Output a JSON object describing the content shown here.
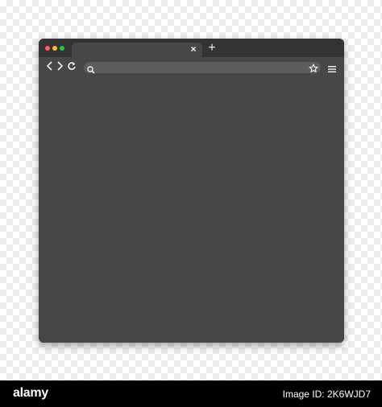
{
  "window": {
    "traffic_lights": [
      {
        "name": "close",
        "color": "#ff5f57"
      },
      {
        "name": "minimize",
        "color": "#febc2e"
      },
      {
        "name": "maximize",
        "color": "#28c840"
      }
    ],
    "tab": {
      "title": "",
      "close_icon": "close-icon",
      "close_glyph": "×"
    },
    "new_tab": {
      "icon": "plus-icon",
      "glyph": "+"
    },
    "toolbar": {
      "back": {
        "icon": "chevron-left-icon",
        "glyph": "‹"
      },
      "forward": {
        "icon": "chevron-right-icon",
        "glyph": "›"
      },
      "reload": {
        "icon": "reload-icon",
        "glyph": "↻"
      },
      "address": {
        "value": "",
        "placeholder": "",
        "search_icon": "search-icon",
        "bookmark_icon": "star-icon"
      },
      "menu_icon": "hamburger-menu-icon"
    },
    "colors": {
      "titlebar": "#333333",
      "window": "#474747",
      "address_bar": "#5d5d5d",
      "icons": "#f2f2f2"
    }
  },
  "footer": {
    "logo": "alamy",
    "image_id": "Image ID: 2K6WJD7"
  }
}
